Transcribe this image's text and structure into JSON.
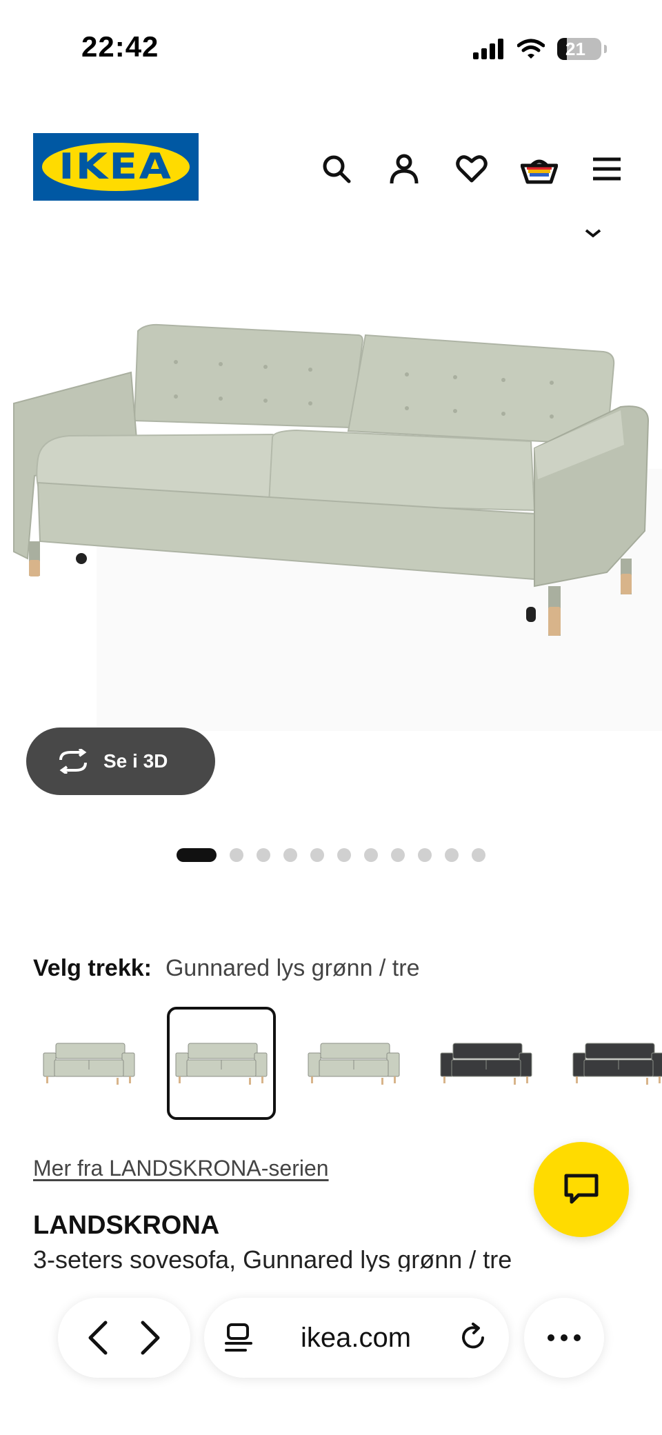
{
  "status_bar": {
    "time": "22:42",
    "battery": "21"
  },
  "header": {
    "logo_text": "IKEA"
  },
  "gallery": {
    "view_3d_label": "Se i 3D",
    "dot_count": 11,
    "active_dot": 0
  },
  "variant": {
    "label": "Velg trekk:",
    "value": "Gunnared lys grønn / tre"
  },
  "swatches": [
    {
      "color": "#c9cfc0",
      "selected": false
    },
    {
      "color": "#c9cfc0",
      "selected": true
    },
    {
      "color": "#c9cfc0",
      "selected": false
    },
    {
      "color": "#3a3b3d",
      "selected": false
    },
    {
      "color": "#3a3b3d",
      "selected": false
    }
  ],
  "series_link": "Mer fra LANDSKRONA-serien",
  "product": {
    "name": "LANDSKRONA",
    "description": "3-seters sovesofa, Gunnared lys grønn / tre"
  },
  "browser": {
    "url": "ikea.com"
  },
  "colors": {
    "ikea_blue": "#0058a3",
    "ikea_yellow": "#ffdb00",
    "sofa": "#c6ccbd",
    "button_dark": "#484848"
  }
}
